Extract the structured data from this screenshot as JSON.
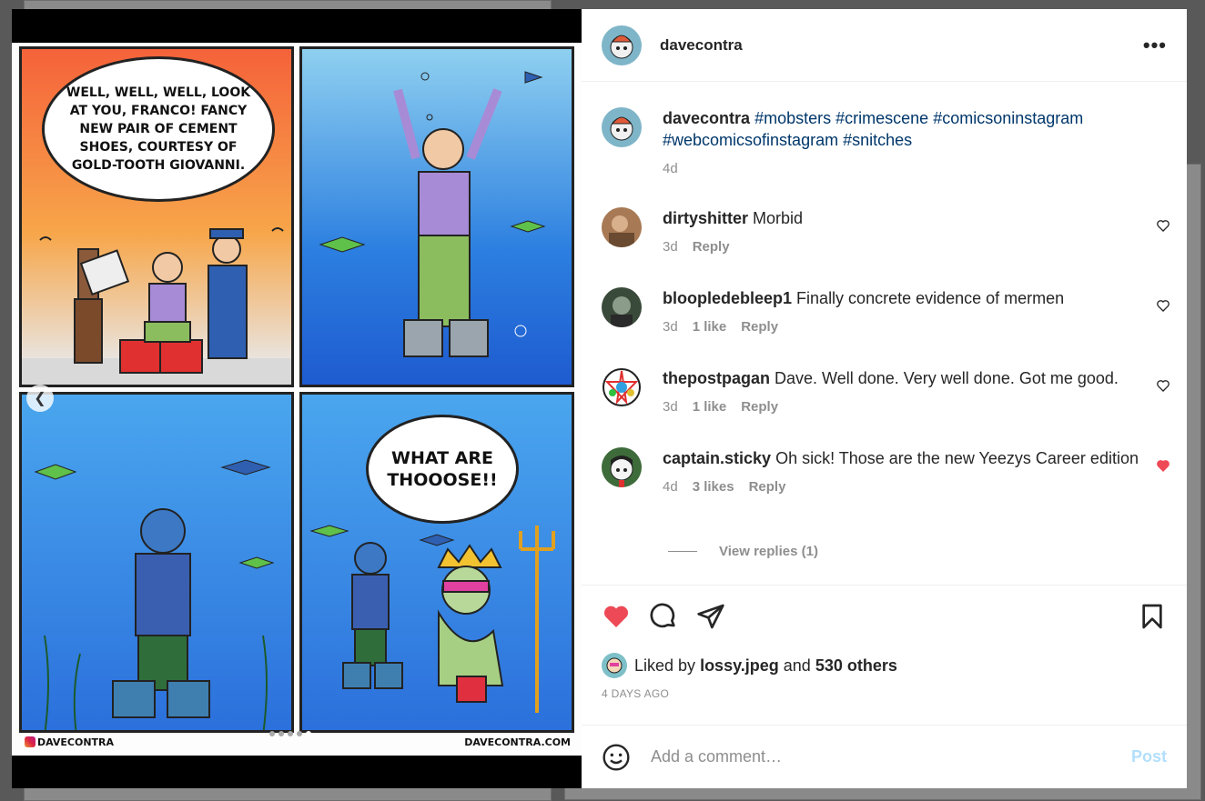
{
  "colors": {
    "accent": "#0095f6",
    "like_red": "#ed4956",
    "muted": "#8e8e8e"
  },
  "comic": {
    "panel1_speech": "WELL, WELL, WELL, LOOK AT YOU, FRANCO! FANCY NEW PAIR OF CEMENT SHOES, COURTESY OF GOLD-TOOTH GIOVANNI.",
    "panel4_speech": "WHAT ARE THOOOSE!!",
    "credit_left": "DAVECONTRA",
    "credit_right": "DAVECONTRA.COM",
    "carousel_count": 5,
    "carousel_active": 5
  },
  "header": {
    "username": "davecontra",
    "more_icon": "more-horizontal-icon"
  },
  "caption": {
    "username": "davecontra",
    "hashtags": [
      "#mobsters",
      "#crimescene",
      "#comicsoninstagram",
      "#webcomicsofinstagram",
      "#snitches"
    ],
    "time": "4d"
  },
  "comments": [
    {
      "username": "dirtyshitter",
      "text": "Morbid",
      "time": "3d",
      "likes": "",
      "reply": "Reply",
      "liked": false
    },
    {
      "username": "bloopledebleep1",
      "text": "Finally concrete evidence of mermen",
      "time": "3d",
      "likes": "1 like",
      "reply": "Reply",
      "liked": false
    },
    {
      "username": "thepostpagan",
      "text": "Dave. Well done. Very well done. Got me good.",
      "time": "3d",
      "likes": "1 like",
      "reply": "Reply",
      "liked": false
    },
    {
      "username": "captain.sticky",
      "text": "Oh sick! Those are the new Yeezys Career edition",
      "time": "4d",
      "likes": "3 likes",
      "reply": "Reply",
      "liked": true
    }
  ],
  "view_replies": "View replies (1)",
  "likes": {
    "prefix": "Liked by",
    "user": "lossy.jpeg",
    "and": "and",
    "others": "530 others"
  },
  "timestamp": "4 DAYS AGO",
  "comment_box": {
    "placeholder": "Add a comment…",
    "post_label": "Post"
  }
}
